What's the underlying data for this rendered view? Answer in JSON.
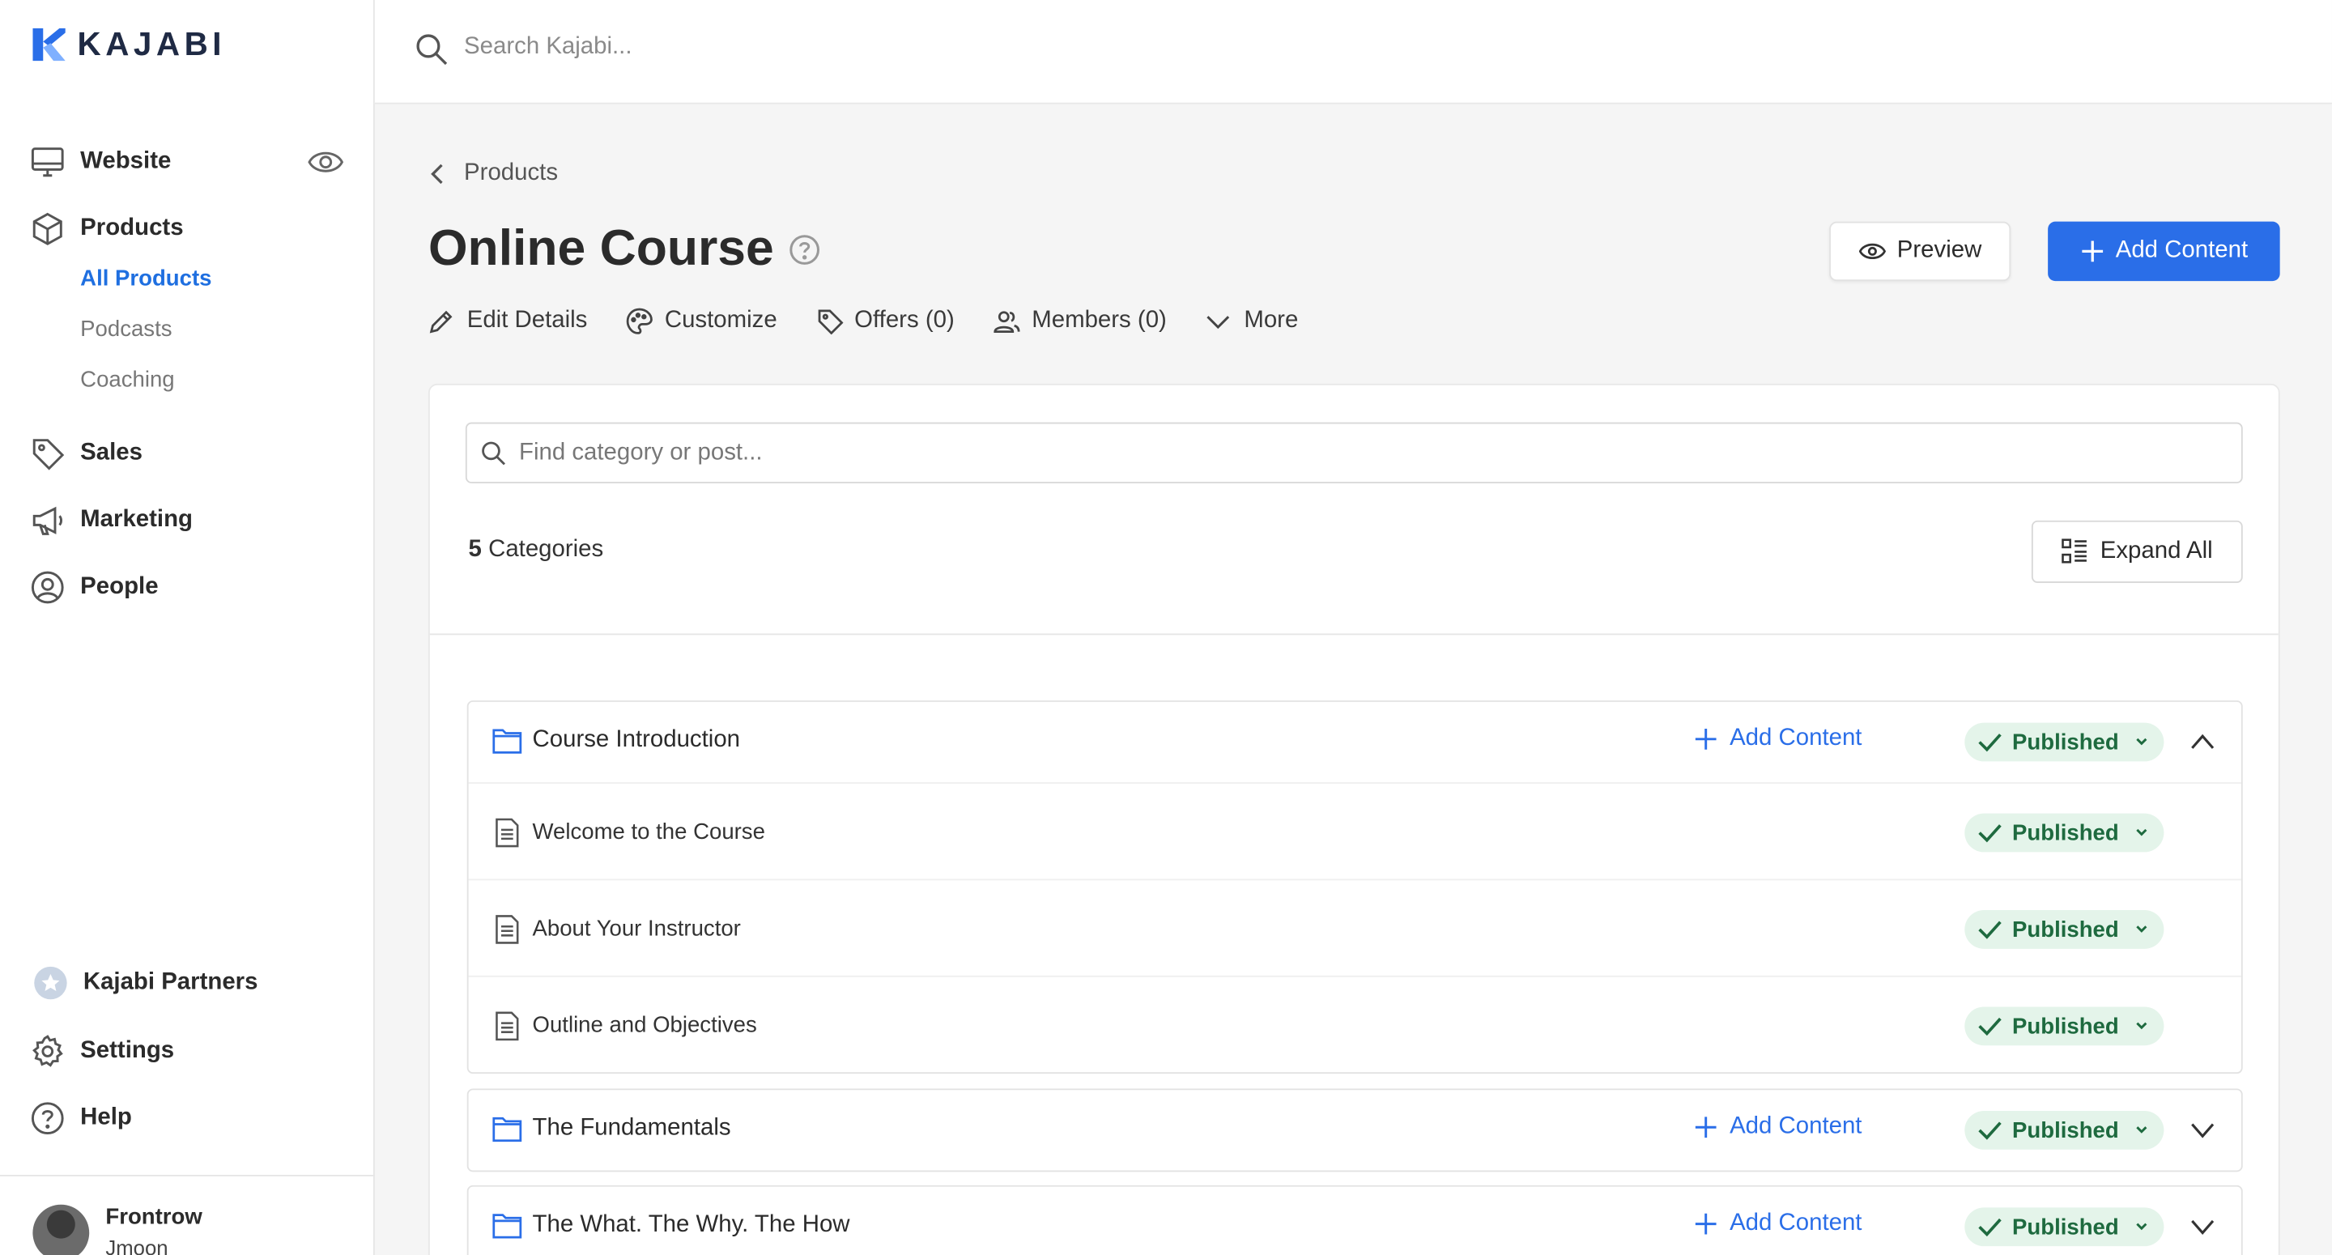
{
  "brand": {
    "logo_text": "KAJABI",
    "accent": "#2a6ee8"
  },
  "sidebar": {
    "nav": [
      {
        "label": "Website",
        "icon": "monitor-icon"
      },
      {
        "label": "Products",
        "icon": "box-icon"
      },
      {
        "label": "Sales",
        "icon": "tag-icon"
      },
      {
        "label": "Marketing",
        "icon": "megaphone-icon"
      },
      {
        "label": "People",
        "icon": "person-circle-icon"
      }
    ],
    "products_sub": [
      "All Products",
      "Podcasts",
      "Coaching"
    ],
    "bottom": [
      {
        "label": "Kajabi Partners",
        "icon": "partners-badge-icon"
      },
      {
        "label": "Settings",
        "icon": "gear-icon"
      },
      {
        "label": "Help",
        "icon": "help-icon"
      }
    ],
    "user": {
      "name": "Frontrow",
      "handle": "Jmoon"
    }
  },
  "topbar": {
    "search_placeholder": "Search Kajabi..."
  },
  "page": {
    "breadcrumb": "Products",
    "title": "Online Course",
    "preview_label": "Preview",
    "add_content_label": "Add Content",
    "tabs": [
      "Edit Details",
      "Customize",
      "Offers (0)",
      "Members (0)",
      "More"
    ]
  },
  "panel": {
    "find_placeholder": "Find category or post...",
    "category_count": "5",
    "category_count_suffix": "Categories",
    "expand_all_label": "Expand All",
    "categories": [
      {
        "title": "Course Introduction",
        "add_label": "Add Content",
        "status": "Published",
        "posts": [
          {
            "title": "Welcome to the Course",
            "status": "Published"
          },
          {
            "title": "About Your Instructor",
            "status": "Published"
          },
          {
            "title": "Outline and Objectives",
            "status": "Published"
          }
        ]
      },
      {
        "title": "The Fundamentals",
        "add_label": "Add Content",
        "status": "Published"
      },
      {
        "title": "The What. The Why. The How",
        "add_label": "Add Content",
        "status": "Published"
      }
    ]
  }
}
